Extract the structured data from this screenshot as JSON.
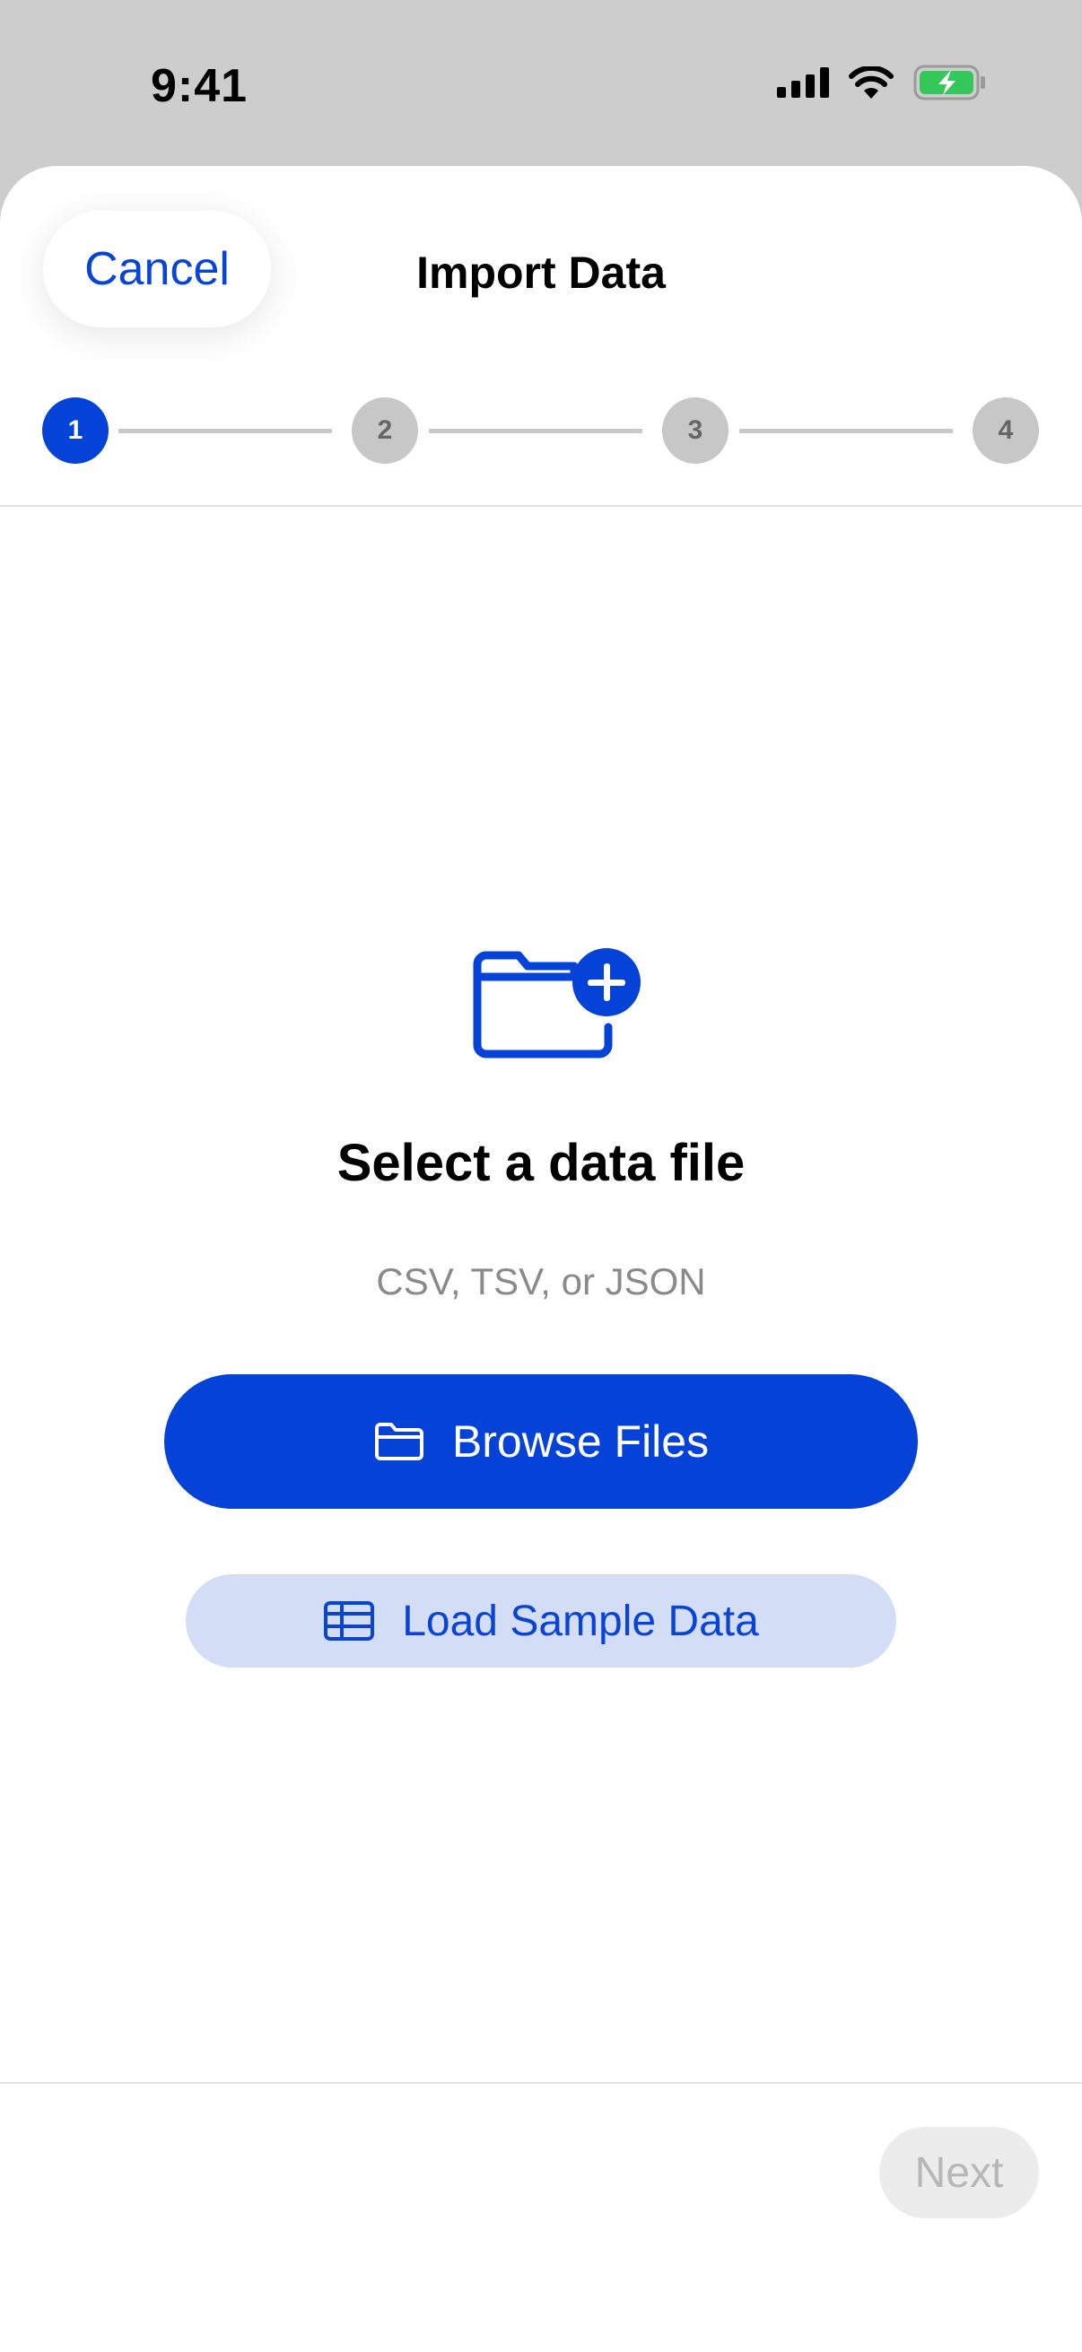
{
  "status_bar": {
    "time": "9:41"
  },
  "header": {
    "cancel_label": "Cancel",
    "title": "Import Data"
  },
  "stepper": {
    "steps": [
      "1",
      "2",
      "3",
      "4"
    ],
    "current_step": 1
  },
  "empty_state": {
    "icon": "folder-add-icon",
    "title": "Select a data file",
    "subtitle": "CSV, TSV, or JSON"
  },
  "actions": {
    "browse_label": "Browse Files",
    "browse_icon": "folder-icon",
    "sample_label": "Load Sample Data",
    "sample_icon": "table-icon"
  },
  "footer": {
    "next_label": "Next",
    "next_enabled": false
  },
  "colors": {
    "accent": "#0442d8",
    "accent_soft": "#d3ddf6",
    "inactive": "#c7c7c7",
    "battery": "#34c759"
  }
}
